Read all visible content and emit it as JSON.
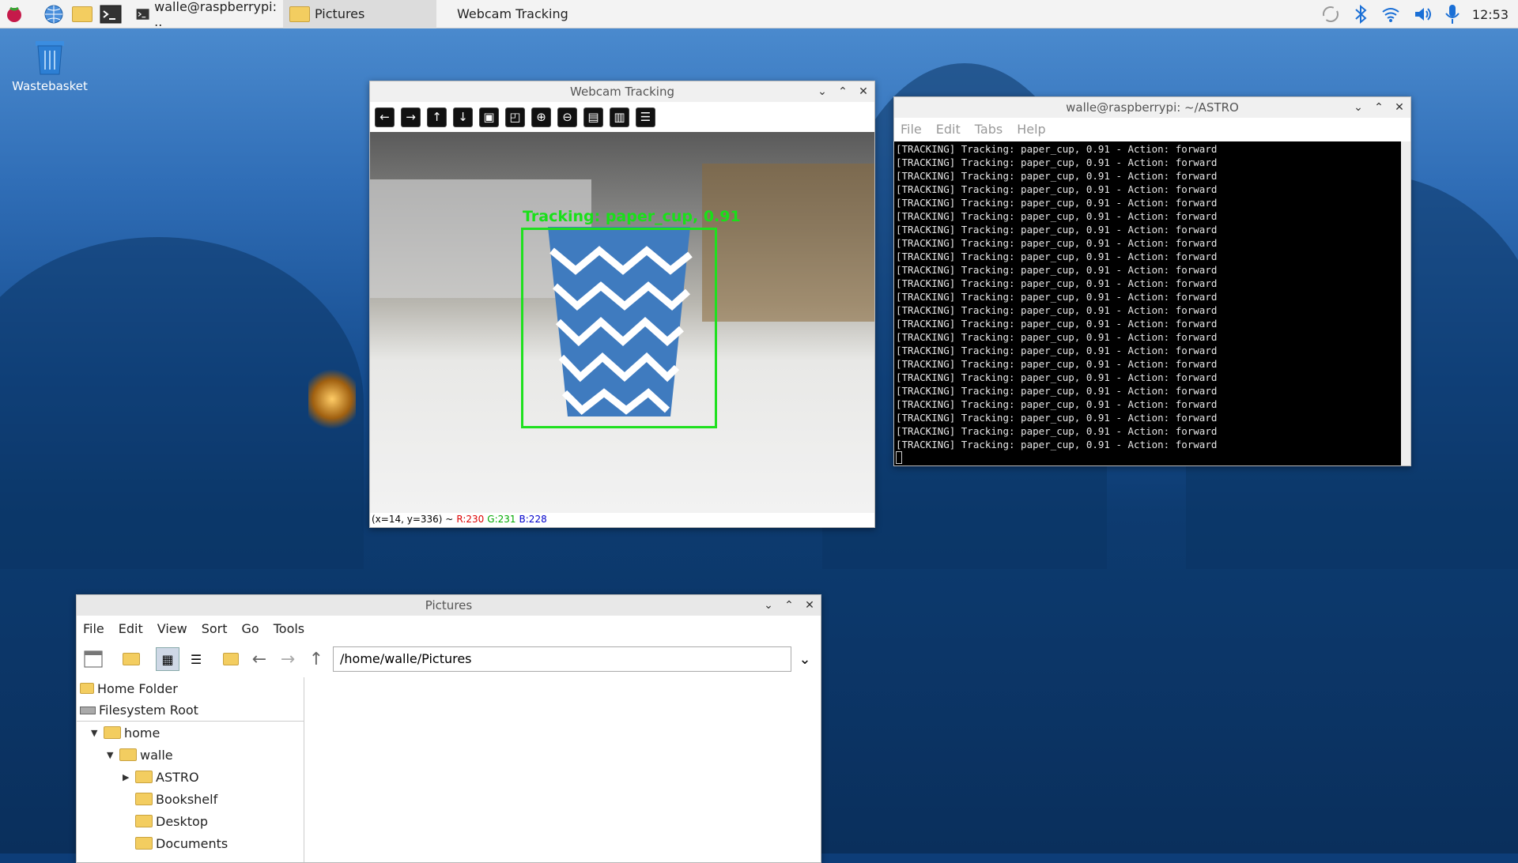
{
  "taskbar": {
    "menu_icon": "raspberry-icon",
    "launchers": [
      "browser-icon",
      "files-icon",
      "terminal-icon"
    ],
    "tasks": [
      {
        "label": "walle@raspberrypi: ..",
        "icon": "terminal-icon",
        "active": false
      },
      {
        "label": "Pictures",
        "icon": "folder-icon",
        "active": true
      },
      {
        "label": "Webcam Tracking",
        "icon": "",
        "active": false
      }
    ],
    "clock": "12:53",
    "tray_icons": [
      "sync-icon",
      "bluetooth-icon",
      "wifi-icon",
      "volume-icon",
      "microphone-icon"
    ]
  },
  "desktop": {
    "wastebasket_label": "Wastebasket"
  },
  "webcam": {
    "title": "Webcam Tracking",
    "overlay_label": "Tracking: paper_cup, 0.91",
    "status_coords": "(x=14, y=336) ~",
    "status_r": "R:230",
    "status_g": "G:231",
    "status_b": "B:228"
  },
  "terminal": {
    "title": "walle@raspberrypi: ~/ASTRO",
    "menu": [
      "File",
      "Edit",
      "Tabs",
      "Help"
    ],
    "line": "[TRACKING] Tracking: paper_cup, 0.91 - Action: forward",
    "line_count": 23
  },
  "files": {
    "title": "Pictures",
    "menu": [
      "File",
      "Edit",
      "View",
      "Sort",
      "Go",
      "Tools"
    ],
    "path": "/home/walle/Pictures",
    "places": [
      "Home Folder",
      "Filesystem Root"
    ],
    "tree": [
      {
        "label": "home",
        "depth": 0,
        "expanded": true
      },
      {
        "label": "walle",
        "depth": 1,
        "expanded": true
      },
      {
        "label": "ASTRO",
        "depth": 2,
        "expanded": false
      },
      {
        "label": "Bookshelf",
        "depth": 2
      },
      {
        "label": "Desktop",
        "depth": 2
      },
      {
        "label": "Documents",
        "depth": 2
      }
    ]
  },
  "colors": {
    "accent": "#00e000",
    "taskbar": "#f3f3f3"
  }
}
